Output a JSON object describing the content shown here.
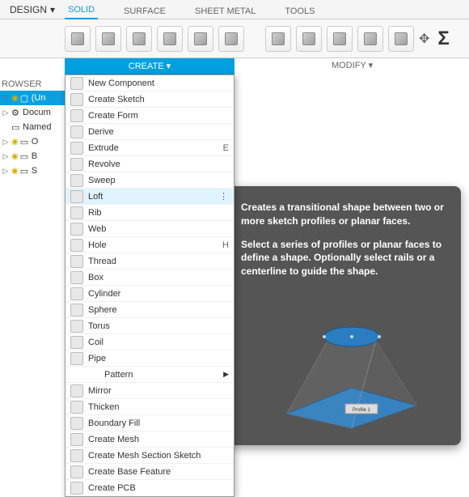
{
  "header": {
    "design_label": "DESIGN",
    "tabs": [
      "SOLID",
      "SURFACE",
      "SHEET METAL",
      "TOOLS"
    ],
    "active_tab": 0
  },
  "ribbon": {
    "create_label": "CREATE ▾",
    "modify_label": "MODIFY ▾",
    "sigma": "Σ"
  },
  "browser": {
    "title": "ROWSER",
    "nodes": [
      {
        "bulb": true,
        "label": "(Un",
        "selected": true
      },
      {
        "exp": "▷",
        "label": "Docum"
      },
      {
        "label": "Named"
      },
      {
        "exp": "▷",
        "bulb": true,
        "label": "O"
      },
      {
        "exp": "▷",
        "bulb": true,
        "label": "B"
      },
      {
        "exp": "▷",
        "bulb": true,
        "label": "S"
      }
    ]
  },
  "create_menu": {
    "items": [
      {
        "icon": "new-component-icon",
        "label": "New Component"
      },
      {
        "icon": "sketch-icon",
        "label": "Create Sketch"
      },
      {
        "icon": "form-icon",
        "label": "Create Form"
      },
      {
        "icon": "derive-icon",
        "label": "Derive"
      },
      {
        "icon": "extrude-icon",
        "label": "Extrude",
        "shortcut": "E"
      },
      {
        "icon": "revolve-icon",
        "label": "Revolve"
      },
      {
        "icon": "sweep-icon",
        "label": "Sweep"
      },
      {
        "icon": "loft-icon",
        "label": "Loft",
        "hover": true,
        "more": "⋮"
      },
      {
        "icon": "rib-icon",
        "label": "Rib"
      },
      {
        "icon": "web-icon",
        "label": "Web"
      },
      {
        "icon": "hole-icon",
        "label": "Hole",
        "shortcut": "H"
      },
      {
        "icon": "thread-icon",
        "label": "Thread"
      },
      {
        "icon": "box-icon",
        "label": "Box"
      },
      {
        "icon": "cylinder-icon",
        "label": "Cylinder"
      },
      {
        "icon": "sphere-icon",
        "label": "Sphere"
      },
      {
        "icon": "torus-icon",
        "label": "Torus"
      },
      {
        "icon": "coil-icon",
        "label": "Coil"
      },
      {
        "icon": "pipe-icon",
        "label": "Pipe"
      },
      {
        "icon": "",
        "label": "Pattern",
        "submenu": true,
        "indent": true
      },
      {
        "icon": "mirror-icon",
        "label": "Mirror"
      },
      {
        "icon": "thicken-icon",
        "label": "Thicken"
      },
      {
        "icon": "boundary-fill-icon",
        "label": "Boundary Fill"
      },
      {
        "icon": "mesh-icon",
        "label": "Create Mesh"
      },
      {
        "icon": "mesh-section-icon",
        "label": "Create Mesh Section Sketch"
      },
      {
        "icon": "base-feature-icon",
        "label": "Create Base Feature"
      },
      {
        "icon": "pcb-icon",
        "label": "Create PCB"
      }
    ]
  },
  "tooltip": {
    "line1": "Creates a transitional shape between two or more sketch profiles or planar faces.",
    "line2": "Select a series of profiles or planar faces to define a shape. Optionally select rails or a centerline to guide the shape.",
    "profile_label": "Profile 1"
  }
}
